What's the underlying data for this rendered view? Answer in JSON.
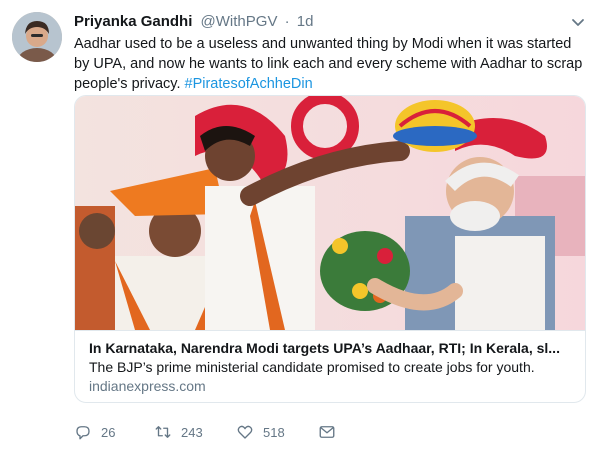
{
  "tweet": {
    "author_name": "Priyanka Gandhi",
    "handle": "@WithPGV",
    "separator": "·",
    "time": "1d",
    "text_main": "Aadhar used to be a useless and unwanted thing by Modi when it was started by UPA, and now he wants to link each and every scheme with Aadhar to scrap people's privacy.",
    "hashtag": "#PiratesofAchheDin"
  },
  "card": {
    "title": "In Karnataka, Narendra Modi targets UPA’s Aadhaar, RTI; In Kerala, sl...",
    "description": "The BJP’s prime ministerial candidate promised to create jobs for youth.",
    "domain": "indianexpress.com"
  },
  "actions": {
    "replies": "26",
    "retweets": "243",
    "likes": "518"
  },
  "colors": {
    "link": "#1b95e0",
    "muted": "#657786",
    "border": "#e1e8ed"
  }
}
